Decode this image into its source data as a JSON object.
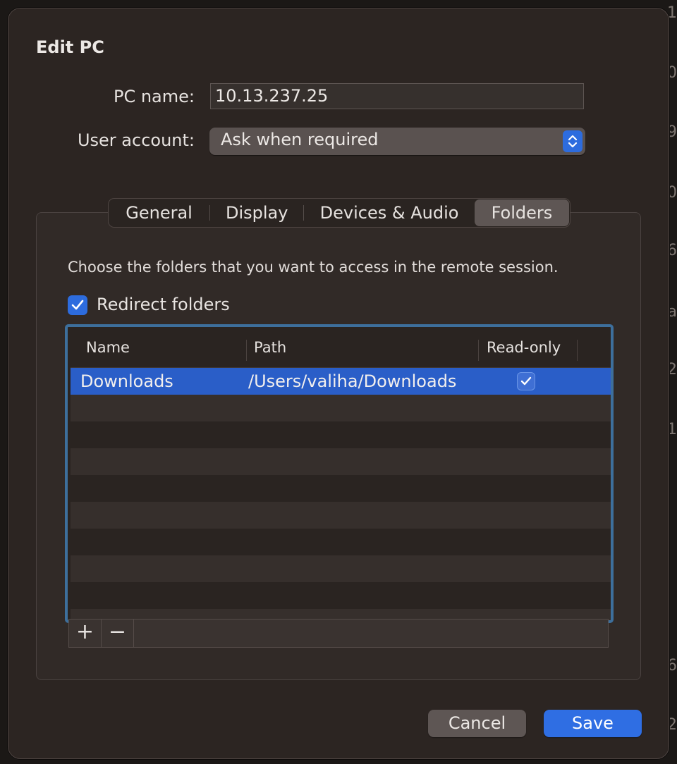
{
  "dialog": {
    "title": "Edit PC"
  },
  "pc_name": {
    "label": "PC name:",
    "value": "10.13.237.25"
  },
  "user_account": {
    "label": "User account:",
    "selected": "Ask when required"
  },
  "tabs": [
    {
      "label": "General",
      "active": false
    },
    {
      "label": "Display",
      "active": false
    },
    {
      "label": "Devices & Audio",
      "active": false
    },
    {
      "label": "Folders",
      "active": true
    }
  ],
  "folders_tab": {
    "description": "Choose the folders that you want to access in the remote session.",
    "redirect_label": "Redirect folders",
    "redirect_checked": true,
    "columns": [
      "Name",
      "Path",
      "Read-only"
    ],
    "rows": [
      {
        "name": "Downloads",
        "path": "/Users/valiha/Downloads",
        "read_only": true,
        "selected": true
      }
    ],
    "add_symbol": "+",
    "remove_symbol": "−"
  },
  "buttons": {
    "cancel": "Cancel",
    "save": "Save"
  },
  "background_glyphs": [
    "1",
    "0",
    "9",
    "0",
    "6",
    "a",
    "2",
    "1",
    "6",
    "2"
  ],
  "colors": {
    "accent": "#2d6cde",
    "selection": "#2a5ec8",
    "focus_ring": "#3d6f9c",
    "dialog_bg": "#2c2522"
  }
}
